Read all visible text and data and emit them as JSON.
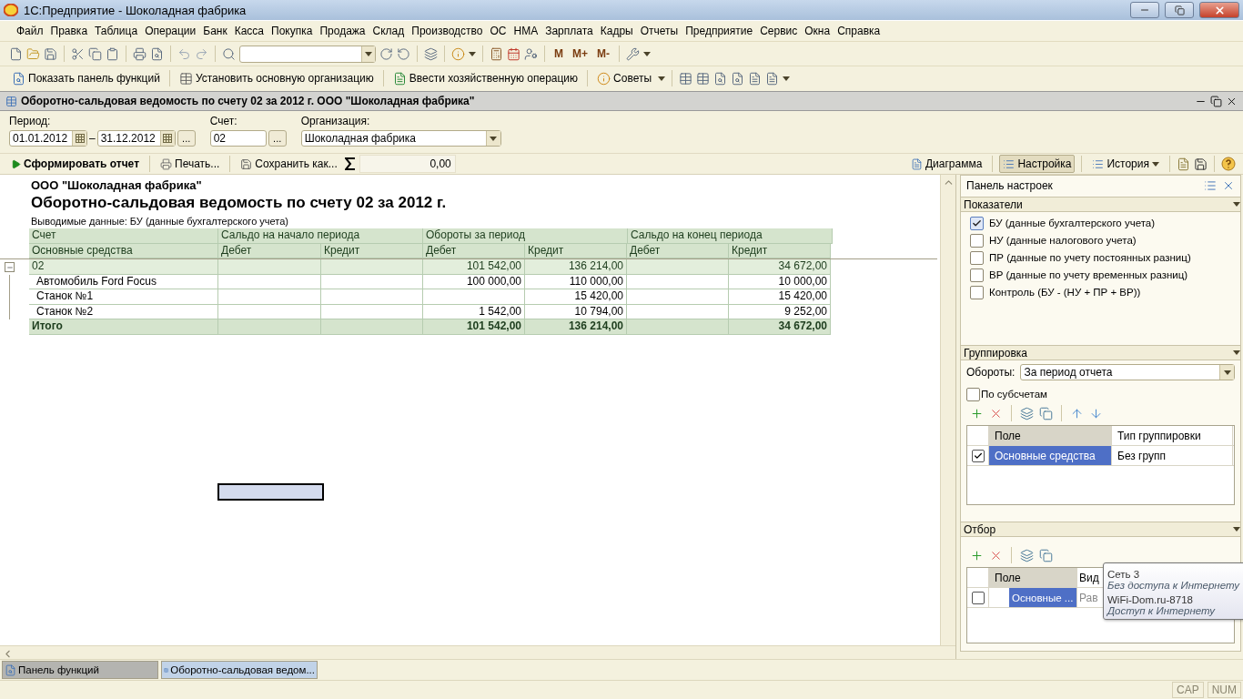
{
  "window": {
    "title": "1С:Предприятие - Шоколадная фабрика"
  },
  "menu": [
    "Файл",
    "Правка",
    "Таблица",
    "Операции",
    "Банк",
    "Касса",
    "Покупка",
    "Продажа",
    "Склад",
    "Производство",
    "ОС",
    "НМА",
    "Зарплата",
    "Кадры",
    "Отчеты",
    "Предприятие",
    "Сервис",
    "Окна",
    "Справка"
  ],
  "toolbar": {
    "memory_buttons": [
      "M",
      "M+",
      "M-"
    ]
  },
  "function_bar": [
    "Показать панель функций",
    "Установить основную организацию",
    "Ввести хозяйственную операцию",
    "Советы"
  ],
  "document": {
    "title": "Оборотно-сальдовая ведомость по счету 02 за 2012 г. ООО \"Шоколадная фабрика\"",
    "period_label": "Период:",
    "period_from": "01.01.2012",
    "period_dash": "–",
    "period_to": "31.12.2012",
    "period_more": "...",
    "account_label": "Счет:",
    "account": "02",
    "account_more": "...",
    "org_label": "Организация:",
    "org": "Шоколадная фабрика"
  },
  "commands": {
    "generate": "Сформировать отчет",
    "print": "Печать...",
    "save": "Сохранить как...",
    "sum": "0,00",
    "right": [
      {
        "label": "Диаграмма",
        "selected": false
      },
      {
        "label": "Настройка",
        "selected": true
      },
      {
        "label": "История",
        "selected": false
      }
    ]
  },
  "report": {
    "org": "ООО \"Шоколадная фабрика\"",
    "title": "Оборотно-сальдовая ведомость по счету 02 за 2012 г.",
    "subtitle": "Выводимые данные:  БУ (данные бухгалтерского учета)",
    "header_top": [
      "Счет",
      "Сальдо на начало периода",
      "Обороты за период",
      "Сальдо на конец периода"
    ],
    "header_sub": [
      "Основные средства",
      "Дебет",
      "Кредит",
      "Дебет",
      "Кредит",
      "Дебет",
      "Кредит"
    ],
    "rows": [
      {
        "kind": "group",
        "cells": [
          "02",
          "",
          "",
          "101 542,00",
          "136 214,00",
          "",
          "34 672,00"
        ]
      },
      {
        "kind": "item",
        "cells": [
          "Автомобиль Ford Focus",
          "",
          "",
          "100 000,00",
          "110 000,00",
          "",
          "10 000,00"
        ]
      },
      {
        "kind": "item",
        "cells": [
          "Станок №1",
          "",
          "",
          "",
          "15 420,00",
          "",
          "15 420,00"
        ]
      },
      {
        "kind": "item",
        "cells": [
          "Станок №2",
          "",
          "",
          "1 542,00",
          "10 794,00",
          "",
          "9 252,00"
        ]
      },
      {
        "kind": "total",
        "cells": [
          "Итого",
          "",
          "",
          "101 542,00",
          "136 214,00",
          "",
          "34 672,00"
        ]
      }
    ]
  },
  "settings": {
    "title": "Панель настроек",
    "indicators": {
      "label": "Показатели",
      "items": [
        {
          "label": "БУ (данные бухгалтерского учета)",
          "checked": true
        },
        {
          "label": "НУ (данные налогового учета)",
          "checked": false
        },
        {
          "label": "ПР (данные по учету постоянных разниц)",
          "checked": false
        },
        {
          "label": "ВР (данные по учету временных разниц)",
          "checked": false
        },
        {
          "label": "Контроль (БУ - (НУ + ПР + ВР))",
          "checked": false
        }
      ]
    },
    "grouping": {
      "label": "Группировка",
      "turnover_label": "Обороты:",
      "turnover": "За период отчета",
      "subaccounts": {
        "label": "По субсчетам",
        "checked": false
      },
      "columns": [
        "Поле",
        "Тип группировки"
      ],
      "rows": [
        {
          "checked": true,
          "field": "Основные средства",
          "type": "Без групп",
          "selected": true
        }
      ]
    },
    "filter": {
      "label": "Отбор",
      "columns": [
        "Поле",
        "Вид"
      ],
      "rows": [
        {
          "checked": false,
          "field": "Основные ...",
          "type": "Рав",
          "selected": true
        }
      ]
    }
  },
  "tooltip": {
    "lines": [
      {
        "kind": "name",
        "text": "Сеть  3"
      },
      {
        "kind": "status",
        "text": "Без доступа к Интернету"
      },
      {
        "kind": "name",
        "text": "WiFi-Dom.ru-8718"
      },
      {
        "kind": "status",
        "text": "Доступ к Интернету"
      }
    ]
  },
  "taskbar": [
    {
      "label": "Панель функций",
      "selected": false
    },
    {
      "label": "Оборотно-сальдовая ведом...",
      "selected": true
    }
  ],
  "status_bar": [
    "CAP",
    "NUM"
  ]
}
